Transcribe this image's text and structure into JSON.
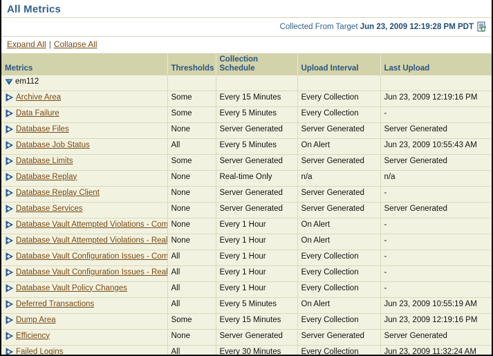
{
  "header": {
    "title": "All Metrics",
    "collected_prefix": "Collected From Target ",
    "collected_timestamp": "Jun 23, 2009 12:19:28 PM PDT",
    "refresh_icon": "refresh-page-icon"
  },
  "actions": {
    "expand_all": "Expand All",
    "separator": "|",
    "collapse_all": "Collapse All"
  },
  "table": {
    "columns": [
      "Metrics",
      "Thresholds",
      "Collection Schedule",
      "Upload Interval",
      "Last Upload"
    ],
    "group": {
      "label": "em112",
      "icon": "triangle-down-icon",
      "expanded": true
    },
    "rows": [
      {
        "icon": "triangle-right-plus-icon",
        "name": "Archive Area",
        "thresholds": "Some",
        "schedule": "Every 15 Minutes",
        "upload_interval": "Every Collection",
        "last_upload": "Jun 23, 2009 12:19:16 PM"
      },
      {
        "icon": "triangle-right-plus-icon",
        "name": "Data Failure",
        "thresholds": "Some",
        "schedule": "Every 5 Minutes",
        "upload_interval": "Every Collection",
        "last_upload": "-"
      },
      {
        "icon": "triangle-right-plus-icon",
        "name": "Database Files",
        "thresholds": "None",
        "schedule": "Server Generated",
        "upload_interval": "Server Generated",
        "last_upload": "Server Generated"
      },
      {
        "icon": "triangle-right-plus-icon",
        "name": "Database Job Status",
        "thresholds": "All",
        "schedule": "Every 5 Minutes",
        "upload_interval": "On Alert",
        "last_upload": "Jun 23, 2009 10:55:43 AM"
      },
      {
        "icon": "triangle-right-plus-icon",
        "name": "Database Limits",
        "thresholds": "Some",
        "schedule": "Server Generated",
        "upload_interval": "Server Generated",
        "last_upload": "Server Generated"
      },
      {
        "icon": "triangle-right-plus-icon",
        "name": "Database Replay",
        "thresholds": "None",
        "schedule": "Real-time Only",
        "upload_interval": "n/a",
        "last_upload": "n/a"
      },
      {
        "icon": "triangle-right-plus-icon",
        "name": "Database Replay Client",
        "thresholds": "None",
        "schedule": "Server Generated",
        "upload_interval": "Server Generated",
        "last_upload": "-"
      },
      {
        "icon": "triangle-right-plus-icon",
        "name": "Database Services",
        "thresholds": "None",
        "schedule": "Server Generated",
        "upload_interval": "Server Generated",
        "last_upload": "Server Generated"
      },
      {
        "icon": "triangle-right-plus-icon",
        "name": "Database Vault Attempted Violations - Command Rules",
        "thresholds": "None",
        "schedule": "Every 1 Hour",
        "upload_interval": "On Alert",
        "last_upload": "-"
      },
      {
        "icon": "triangle-right-plus-icon",
        "name": "Database Vault Attempted Violations - Realms",
        "thresholds": "None",
        "schedule": "Every 1 Hour",
        "upload_interval": "On Alert",
        "last_upload": "-"
      },
      {
        "icon": "triangle-right-plus-icon",
        "name": "Database Vault Configuration Issues - Command Rules",
        "thresholds": "All",
        "schedule": "Every 1 Hour",
        "upload_interval": "Every Collection",
        "last_upload": "-"
      },
      {
        "icon": "triangle-right-plus-icon",
        "name": "Database Vault Configuration Issues - Realms",
        "thresholds": "All",
        "schedule": "Every 1 Hour",
        "upload_interval": "Every Collection",
        "last_upload": "-"
      },
      {
        "icon": "triangle-right-plus-icon",
        "name": "Database Vault Policy Changes",
        "thresholds": "All",
        "schedule": "Every 1 Hour",
        "upload_interval": "Every Collection",
        "last_upload": "-"
      },
      {
        "icon": "triangle-right-plus-icon",
        "name": "Deferred Transactions",
        "thresholds": "All",
        "schedule": "Every 5 Minutes",
        "upload_interval": "On Alert",
        "last_upload": "Jun 23, 2009 10:55:19 AM"
      },
      {
        "icon": "triangle-right-plus-icon",
        "name": "Dump Area",
        "thresholds": "Some",
        "schedule": "Every 15 Minutes",
        "upload_interval": "Every Collection",
        "last_upload": "Jun 23, 2009 12:19:16 PM"
      },
      {
        "icon": "triangle-right-plus-icon",
        "name": "Efficiency",
        "thresholds": "None",
        "schedule": "Server Generated",
        "upload_interval": "Server Generated",
        "last_upload": "Server Generated"
      },
      {
        "icon": "triangle-right-plus-icon",
        "name": "Failed Logins",
        "thresholds": "All",
        "schedule": "Every 30 Minutes",
        "upload_interval": "Every Collection",
        "last_upload": "Jun 23, 2009 11:32:24 AM"
      }
    ]
  },
  "colors": {
    "title": "#31618c",
    "link": "#7a4a12",
    "header_bg": "#d3d3ab",
    "row_bg": "#f2f2e1",
    "grid": "#d9d9bb"
  }
}
